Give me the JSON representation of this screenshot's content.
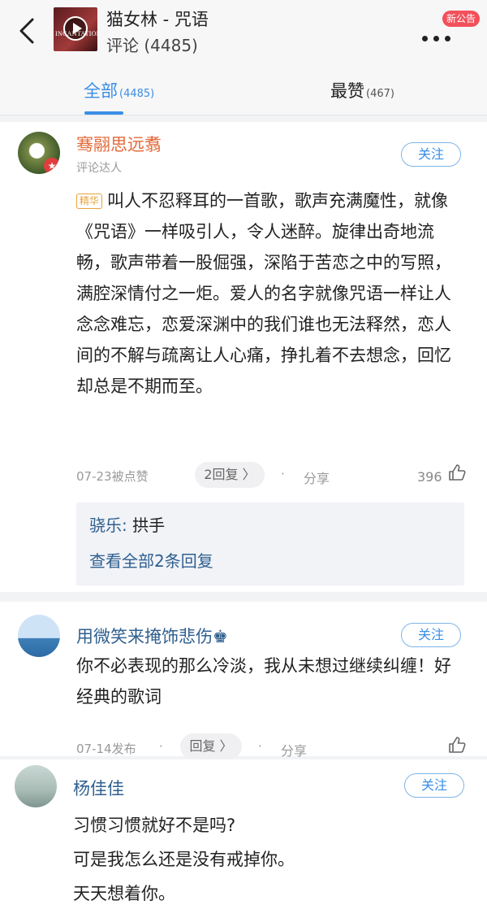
{
  "header": {
    "title": "猫女林 - 咒语",
    "subtitle": "评论 (4485)",
    "cover_text": "INCANTATION",
    "notice_badge": "新公告"
  },
  "tabs": [
    {
      "label": "全部",
      "count": "(4485)"
    },
    {
      "label": "最赞",
      "count": "(467)"
    }
  ],
  "comments": [
    {
      "username": "骞翮思远翥",
      "tag": "评论达人",
      "follow_label": "关注",
      "badge": "精华",
      "content": "叫人不忍释耳的一首歌，歌声充满魔性，就像《咒语》一样吸引人，令人迷醉。旋律出奇地流畅，歌声带着一股倔强，深陷于苦恋之中的写照，满腔深情付之一炬。爱人的名字就像咒语一样让人念念难忘，恋爱深渊中的我们谁也无法释然，恋人间的不解与疏离让人心痛，挣扎着不去想念，回忆却总是不期而至。",
      "date": "07-23被点赞",
      "replies_label": "2回复 〉",
      "separator": "·",
      "share_label": "分享",
      "likes": "396",
      "reply_preview": {
        "name": "骁乐:",
        "text": "拱手",
        "view_all": "查看全部2条回复"
      }
    },
    {
      "username": "用微笑来掩饰悲伤♚",
      "follow_label": "关注",
      "content": "你不必表现的那么冷淡，我从未想过继续纠缠！好经典的歌词",
      "date": "07-14发布",
      "replies_label": "回复 〉",
      "separator": "·",
      "share_label": "分享"
    },
    {
      "username": "杨佳佳",
      "follow_label": "关注",
      "lines": [
        "习惯习惯就好不是吗?",
        "可是我怎么还是没有戒掉你。",
        "天天想着你。"
      ]
    }
  ],
  "colors": {
    "accent": "#3a8ee6",
    "hot_user": "#e36a39",
    "user": "#2f5f8f",
    "badge": "#f2505a"
  }
}
